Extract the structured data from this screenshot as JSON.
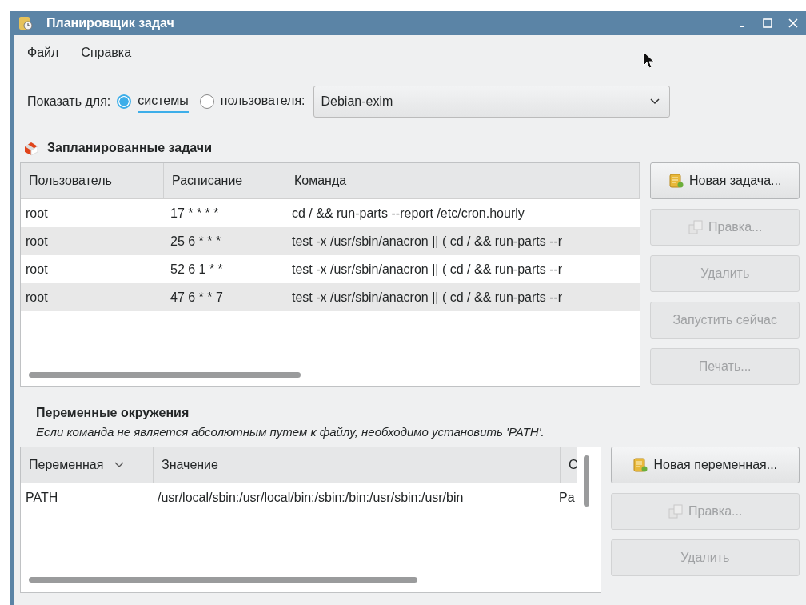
{
  "window": {
    "title": "Планировщик задач"
  },
  "menu": [
    "Файл",
    "Справка"
  ],
  "show_for": {
    "label": "Показать для:",
    "options": [
      {
        "label": "системы",
        "selected": true
      },
      {
        "label": "пользователя:",
        "selected": false
      }
    ],
    "user_select": {
      "value": "Debian-exim"
    }
  },
  "tasks": {
    "title": "Запланированные задачи",
    "columns": [
      "Пользователь",
      "Расписание",
      "Команда"
    ],
    "rows": [
      {
        "user": "root",
        "schedule": "17 * * * *",
        "command": "cd / && run-parts --report /etc/cron.hourly"
      },
      {
        "user": "root",
        "schedule": "25 6 * * *",
        "command": "test -x /usr/sbin/anacron || ( cd / && run-parts --r"
      },
      {
        "user": "root",
        "schedule": "52 6 1 * *",
        "command": "test -x /usr/sbin/anacron || ( cd / && run-parts --r"
      },
      {
        "user": "root",
        "schedule": "47 6 * * 7",
        "command": "test -x /usr/sbin/anacron || ( cd / && run-parts --r"
      }
    ]
  },
  "task_buttons": [
    {
      "label": "Новая задача...",
      "kind": "new",
      "disabled": false
    },
    {
      "label": "Правка...",
      "kind": "edit",
      "disabled": true
    },
    {
      "label": "Удалить",
      "kind": "plain",
      "disabled": true
    },
    {
      "label": "Запустить сейчас",
      "kind": "plain",
      "disabled": true
    },
    {
      "label": "Печать...",
      "kind": "plain",
      "disabled": true
    }
  ],
  "environment": {
    "title": "Переменные окружения",
    "note": "Если команда не является абсолютным путем к файлу, необходимо установить 'PATH'.",
    "columns": [
      {
        "label": "Переменная",
        "sorted": true
      },
      {
        "label": "Значение",
        "sorted": false
      },
      {
        "label": "С",
        "sorted": false
      }
    ],
    "rows": [
      {
        "name": "PATH",
        "value": "/usr/local/sbin:/usr/local/bin:/sbin:/bin:/usr/sbin:/usr/bin",
        "column_3": "Pa"
      }
    ]
  },
  "env_buttons": [
    {
      "label": "Новая переменная...",
      "kind": "new",
      "disabled": false
    },
    {
      "label": "Правка...",
      "kind": "edit",
      "disabled": true
    },
    {
      "label": "Удалить",
      "kind": "plain",
      "disabled": true
    }
  ]
}
